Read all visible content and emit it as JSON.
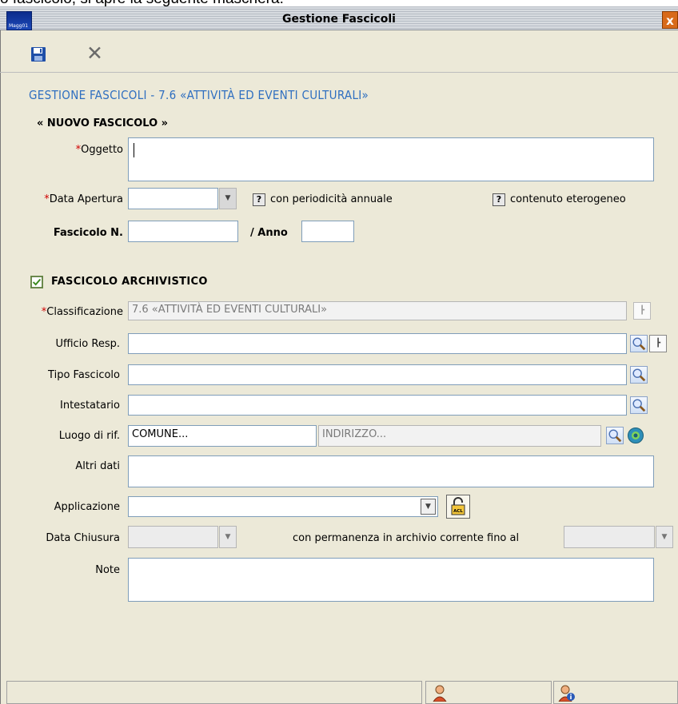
{
  "caption": "o fascicolo, si apre la seguente maschera:",
  "window": {
    "title": "Gestione Fascicoli",
    "icon_label": "Magg01",
    "close_label": "x"
  },
  "heading": "GESTIONE FASCICOLI - 7.6 «ATTIVITÀ ED EVENTI CULTURALI»",
  "subheading": "« NUOVO FASCICOLO »",
  "required_mark": "*",
  "fields": {
    "oggetto": {
      "label": "Oggetto",
      "value": ""
    },
    "data_apertura": {
      "label": "Data Apertura",
      "value": ""
    },
    "periodicita": {
      "label": "con periodicità annuale",
      "mark": "?"
    },
    "eterogeneo": {
      "label": "contenuto eterogeneo",
      "mark": "?"
    },
    "fascicolo_n": {
      "label": "Fascicolo N.",
      "value": ""
    },
    "anno": {
      "label": "/ Anno",
      "value": ""
    }
  },
  "section": {
    "label": "FASCICOLO ARCHIVISTICO",
    "checked": true
  },
  "archivistico": {
    "classificazione": {
      "label": "Classificazione",
      "value": "7.6 «ATTIVITÀ ED EVENTI CULTURALI»"
    },
    "ufficio": {
      "label": "Ufficio Resp.",
      "value": ""
    },
    "tipo": {
      "label": "Tipo Fascicolo",
      "value": ""
    },
    "intestatario": {
      "label": "Intestatario",
      "value": ""
    },
    "luogo": {
      "label": "Luogo di rif.",
      "comune": "COMUNE...",
      "indirizzo": "INDIRIZZO..."
    },
    "altri_dati": {
      "label": "Altri dati",
      "value": ""
    },
    "applicazione": {
      "label": "Applicazione",
      "value": "",
      "acl_label": "ACL"
    },
    "data_chiusura": {
      "label": "Data Chiusura",
      "value": ""
    },
    "permanenza": {
      "label": "con permanenza in archivio corrente fino al",
      "value": ""
    },
    "note": {
      "label": "Note",
      "value": ""
    }
  },
  "colors": {
    "heading": "#2f6fc0",
    "required": "#d00000",
    "window_bg": "#ece9d8"
  }
}
